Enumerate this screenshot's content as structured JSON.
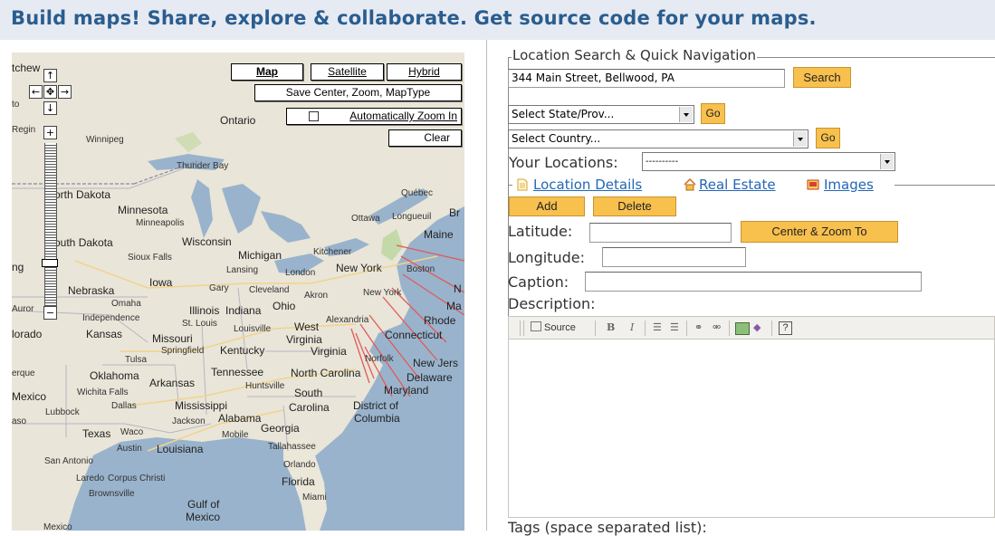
{
  "banner": {
    "text": "Build maps! Share, explore & collaborate. Get source code for your maps."
  },
  "map": {
    "type_buttons": {
      "map": "Map",
      "satellite": "Satellite",
      "hybrid": "Hybrid"
    },
    "save_button": "Save Center, Zoom, MapType",
    "auto_zoom_label": "Automatically Zoom In",
    "clear_button": "Clear",
    "labels": {
      "ontario": "Ontario",
      "winnipeg": "Winnipeg",
      "regina": "Regin",
      "thunder_bay": "Thunder Bay",
      "north_dakota": "orth Dakota",
      "minnesota": "Minnesota",
      "minneapolis": "Minneapolis",
      "wisconsin": "Wisconsin",
      "south_dakota": "outh Dakota",
      "sioux_falls": "Sioux Falls",
      "michigan": "Michigan",
      "lansing": "Lansing",
      "kitchener": "Kitchener",
      "london": "London",
      "nebraska": "Nebraska",
      "iowa": "Iowa",
      "gary": "Gary",
      "cleveland": "Cleveland",
      "akron": "Akron",
      "omaha": "Omaha",
      "independence": "Independence",
      "illinois": "Illinois",
      "indiana": "Indiana",
      "ohio": "Ohio",
      "aurora": "Auror",
      "colorado": "lorado",
      "kansas": "Kansas",
      "st_louis": "St. Louis",
      "missouri": "Missouri",
      "louisville": "Louisville",
      "west": "West",
      "virginia_w": "Virginia",
      "springfield": "Springfield",
      "kentucky": "Kentucky",
      "virginia": "Virginia",
      "alexandria": "Alexandria",
      "norfolk": "Norfolk",
      "tulsa": "Tulsa",
      "oklahoma": "Oklahoma",
      "arkansas": "Arkansas",
      "tennessee": "Tennessee",
      "north_carolina": "North Carolina",
      "huntsville": "Huntsville",
      "south": "South",
      "carolina": "Carolina",
      "albuquerque": "erque",
      "mexico": "Mexico",
      "wichita_falls": "Wichita Falls",
      "dallas": "Dallas",
      "mississippi": "Mississippi",
      "lubbock": "Lubbock",
      "jackson": "Jackson",
      "alabama": "Alabama",
      "georgia": "Georgia",
      "el_paso": "aso",
      "texas": "Texas",
      "waco": "Waco",
      "mobile": "Mobile",
      "austin": "Austin",
      "louisiana": "Louisiana",
      "tallahassee": "Tallahassee",
      "san_antonio": "San Antonio",
      "orlando": "Orlando",
      "laredo": "Laredo",
      "corpus_christi": "Corpus Christi",
      "florida": "Florida",
      "brownsville": "Brownsville",
      "miami": "Miami",
      "gulf_of": "Gulf of",
      "gulf_mexico": "Mexico",
      "mexico_bottom": "Mexico",
      "quebec": "Québec",
      "ottawa": "Ottawa",
      "longueuil": "Longueuil",
      "br": "Br",
      "maine": "Maine",
      "new_york": "New York",
      "boston": "Boston",
      "n": "N",
      "new_york_city": "New York",
      "ma": "Ma",
      "rhode": "Rhode",
      "connecticut": "Connecticut",
      "new_jersey": "New Jers",
      "delaware": "Delaware",
      "maryland": "Maryland",
      "district_of": "District of",
      "columbia": "Columbia",
      "chewan": "tchew",
      "to": "to",
      "ng": "ng"
    }
  },
  "search": {
    "legend": "Location Search & Quick Navigation",
    "address_value": "344 Main Street, Bellwood, PA",
    "search_button": "Search",
    "state_select": "Select State/Prov...",
    "state_go": "Go",
    "country_select": "Select Country...",
    "country_go": "Go",
    "your_locations_label": "Your Locations:",
    "your_locations_value": "----------"
  },
  "details": {
    "tabs": {
      "location_details": "Location Details",
      "real_estate": "Real Estate",
      "images": "Images"
    },
    "add_button": "Add",
    "delete_button": "Delete",
    "latitude_label": "Latitude:",
    "center_zoom_button": "Center & Zoom To",
    "longitude_label": "Longitude:",
    "caption_label": "Caption:",
    "description_label": "Description:",
    "toolbar": {
      "source": "Source",
      "bold": "B",
      "italic": "I"
    },
    "tags_label": "Tags (space separated list):"
  }
}
